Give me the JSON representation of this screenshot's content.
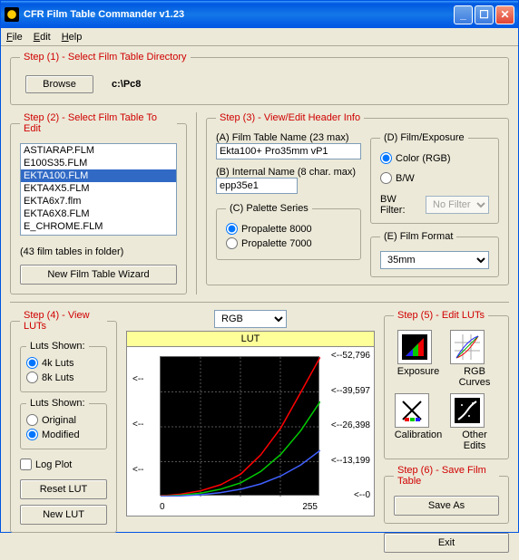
{
  "titlebar": {
    "title": "CFR Film Table Commander v1.23"
  },
  "menu": {
    "file": "File",
    "edit": "Edit",
    "help": "Help"
  },
  "step1": {
    "legend": "Step (1) - Select Film Table Directory",
    "browse": "Browse",
    "path": "c:\\Pc8"
  },
  "step2": {
    "legend": "Step (2) - Select Film Table To Edit",
    "items": [
      "ASTIARAP.FLM",
      "E100S35.FLM",
      "EKTA100.FLM",
      "EKTA4X5.FLM",
      "EKTA6x7.flm",
      "EKTA6X8.FLM",
      "E_CHROME.FLM"
    ],
    "selectedIndex": 2,
    "count": "(43 film tables in folder)",
    "wizard": "New Film Table Wizard"
  },
  "step3": {
    "legend": "Step (3) - View/Edit Header Info",
    "a_label": "(A) Film Table Name (23 max)",
    "a_value": "Ekta100+ Pro35mm vP1",
    "b_label": "(B) Internal Name (8 char. max)",
    "b_value": "epp35e1",
    "c": {
      "legend": "(C) Palette Series",
      "opt1": "Propalette 8000",
      "opt2": "Propalette 7000"
    },
    "d": {
      "legend": "(D) Film/Exposure",
      "color": "Color (RGB)",
      "bw": "B/W",
      "bwfilter_label": "BW Filter:",
      "bwfilter_value": "No Filter"
    },
    "e": {
      "legend": "(E) Film Format",
      "value": "35mm"
    }
  },
  "step4": {
    "legend": "Step (4) - View LUTs",
    "shown1": {
      "legend": "Luts Shown:",
      "o1": "4k Luts",
      "o2": "8k Luts"
    },
    "shown2": {
      "legend": "Luts Shown:",
      "o1": "Original",
      "o2": "Modified"
    },
    "log": "Log Plot",
    "reset": "Reset LUT",
    "new": "New LUT"
  },
  "chart": {
    "select": "RGB",
    "title": "LUT",
    "xmin": "0",
    "xmax": "255"
  },
  "step5": {
    "legend": "Step (5) - Edit LUTs",
    "exposure": "Exposure",
    "rgb": "RGB Curves",
    "calib": "Calibration",
    "other": "Other Edits"
  },
  "step6": {
    "legend": "Step (6) - Save Film Table",
    "save": "Save As",
    "exit": "Exit"
  },
  "chart_data": {
    "type": "line",
    "title": "LUT",
    "xlabel": "",
    "ylabel": "",
    "xlim": [
      0,
      255
    ],
    "ylim": [
      0,
      52796
    ],
    "yticks": [
      0,
      13199,
      26398,
      39597,
      52796
    ],
    "x": [
      0,
      32,
      64,
      96,
      128,
      160,
      192,
      224,
      255
    ],
    "series": [
      {
        "name": "R",
        "color": "#ff0000",
        "values": [
          200,
          900,
          2200,
          4500,
          8500,
          15800,
          26000,
          39500,
          52796
        ]
      },
      {
        "name": "G",
        "color": "#00cc00",
        "values": [
          100,
          500,
          1300,
          2800,
          5200,
          9500,
          16000,
          25000,
          36000
        ]
      },
      {
        "name": "B",
        "color": "#4060ff",
        "values": [
          50,
          250,
          700,
          1500,
          2800,
          4800,
          7800,
          12000,
          17500
        ]
      }
    ]
  }
}
